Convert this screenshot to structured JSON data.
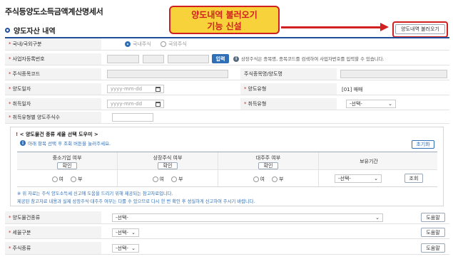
{
  "page_title": "주식등양도소득금액계산명세서",
  "section_title": "양도자산 내역",
  "callout": {
    "line1": "양도내역 불러오기",
    "line2": "기능 신설"
  },
  "load_button": "양도내역 불러오기",
  "form": {
    "domestic_foreign": {
      "label": "국내/국외구분",
      "options": [
        "국내주식",
        "국외주식"
      ],
      "selected": "국내주식"
    },
    "biz_number": {
      "label": "사업자등록번호",
      "enter_button": "입력",
      "hint": "상장주식은 종목명, 종목코드를 검색하여 사업자번호를 입력할 수 있습니다."
    },
    "stock_code": {
      "label": "주식종목코드",
      "name_label": "주식종목명/양도명"
    },
    "transfer_date": {
      "label": "양도일자",
      "placeholder": "yyyy-mm-dd",
      "type_label": "양도유형",
      "type_value": "[01] 매매"
    },
    "acquire_date": {
      "label": "취득일자",
      "placeholder": "yyyy-mm-dd",
      "type_label": "취득유형",
      "type_value": "-선택-"
    },
    "qty": {
      "label": "취득유형별 양도주식수"
    }
  },
  "helper": {
    "title": "< 양도물건 종류 세율 선택 도우미 >",
    "subtitle": "아래 항목 선택 후 조회 버튼을 눌러주세요.",
    "reset_button": "초기화",
    "columns": [
      {
        "header": "중소기업 여부",
        "confirm": "확인"
      },
      {
        "header": "상장주식 여부",
        "confirm": "확인"
      },
      {
        "header": "대주주 여부",
        "confirm": "확인"
      },
      {
        "header": "보유기간"
      }
    ],
    "yes": "여",
    "no": "부",
    "period_select": "-선택-",
    "query_button": "조회",
    "note1": "※ 위 자료는 주식 양도소득세 신고에 도움을 드리기 위해 제공되는 참고자료입니다.",
    "note2": "제공된 참고자료 내용과 실제 상장주식·대주주 여부는 다를 수 있으므로 다시 한 번 확인 후 성실하게 신고하여 주시기 바랍니다."
  },
  "bottom": {
    "kind": {
      "label": "양도물건종류",
      "value": "-선택-"
    },
    "tax": {
      "label": "세율구분",
      "value": "-선택-"
    },
    "stock": {
      "label": "주식종류",
      "value": "-선택-"
    },
    "help_button": "도움말"
  }
}
